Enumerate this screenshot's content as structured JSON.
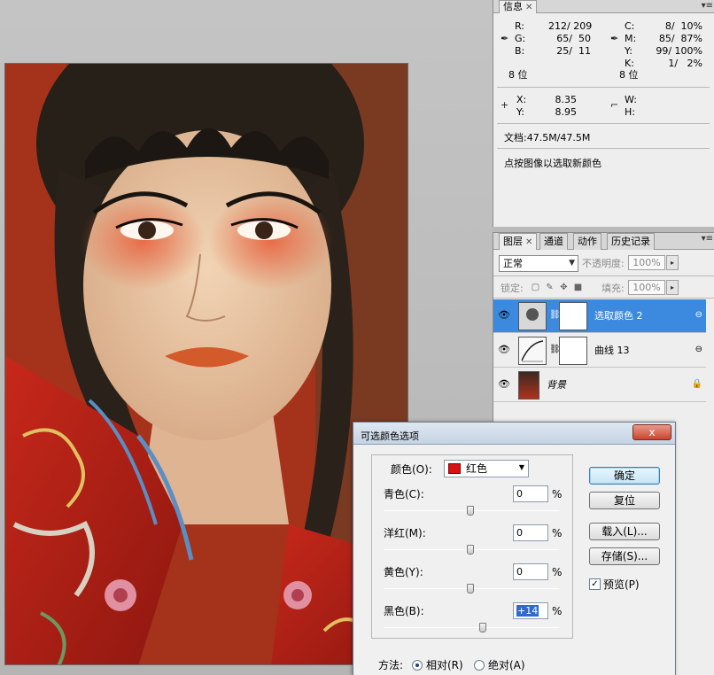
{
  "info_panel": {
    "tab_label": "信息",
    "rgb": {
      "r_label": "R:",
      "r_value": "212/ 209",
      "g_label": "G:",
      "g_value": "65/  50",
      "b_label": "B:",
      "b_value": "25/  11",
      "bit": "8 位"
    },
    "cmyk": {
      "c_label": "C:",
      "c_value": "8/  10%",
      "m_label": "M:",
      "m_value": "85/  87%",
      "y_label": "Y:",
      "y_value": "99/ 100%",
      "k_label": "K:",
      "k_value": "1/   2%",
      "bit": "8 位"
    },
    "position": {
      "x_label": "X:",
      "x_value": "8.35",
      "y_label": "Y:",
      "y_value": "8.95"
    },
    "size": {
      "w_label": "W:",
      "h_label": "H:"
    },
    "doc": "文档:47.5M/47.5M",
    "hint": "点按图像以选取新颜色"
  },
  "layers_panel": {
    "tabs": [
      "图层",
      "通道",
      "动作",
      "历史记录"
    ],
    "blend_mode": "正常",
    "opacity_label": "不透明度:",
    "opacity_value": "100%",
    "lock_label": "锁定:",
    "fill_label": "填充:",
    "fill_value": "100%",
    "layers": [
      {
        "name": "选取颜色 2",
        "active": true
      },
      {
        "name": "曲线 13",
        "active": false
      },
      {
        "name": "背景",
        "active": false
      }
    ]
  },
  "dialog": {
    "title": "可选颜色选项",
    "close": "x",
    "color_label": "颜色(O):",
    "color_value": "红色",
    "sliders": [
      {
        "label": "青色(C):",
        "value": "0",
        "unit": "%",
        "position": 0.5
      },
      {
        "label": "洋红(M):",
        "value": "0",
        "unit": "%",
        "position": 0.5
      },
      {
        "label": "黄色(Y):",
        "value": "0",
        "unit": "%",
        "position": 0.5
      },
      {
        "label": "黑色(B):",
        "value": "+14",
        "unit": "%",
        "position": 0.57
      }
    ],
    "buttons": {
      "ok": "确定",
      "reset": "复位",
      "load": "载入(L)...",
      "save": "存储(S)..."
    },
    "preview_label": "预览(P)",
    "preview_checked": true,
    "method_label": "方法:",
    "method_relative": "相对(R)",
    "method_absolute": "绝对(A)",
    "method_selected": "relative"
  },
  "colors": {
    "swatch_red": "#d71414",
    "selection_blue": "#3b8ae0"
  }
}
